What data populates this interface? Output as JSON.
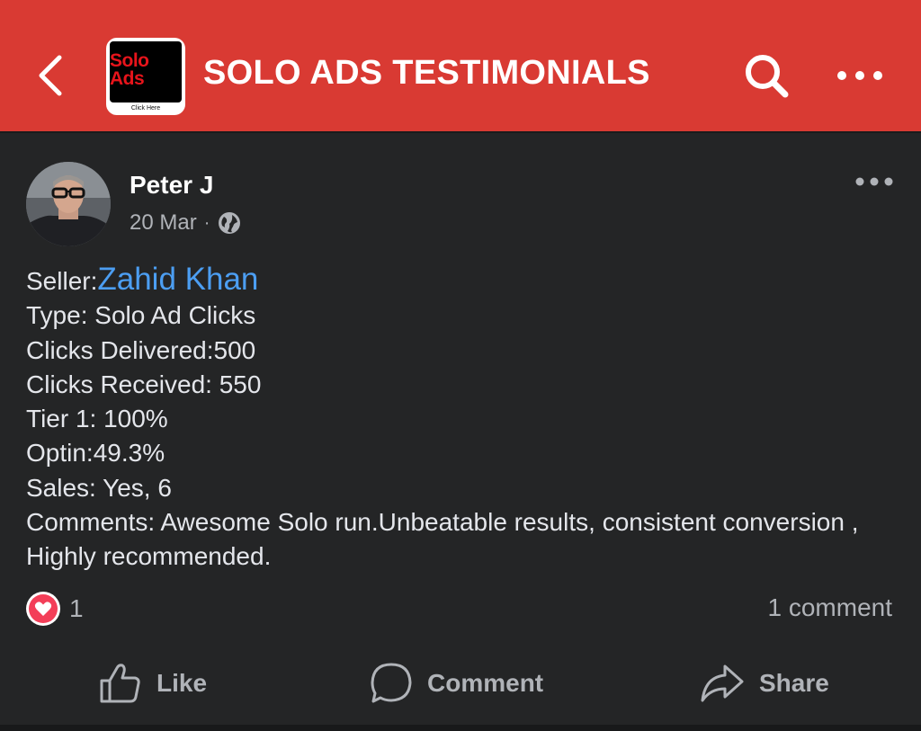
{
  "header": {
    "title": "SOLO ADS TESTIMONIALS",
    "logo_text_1": "Solo",
    "logo_text_2": "Ads",
    "logo_caption": "Click Here",
    "background_color": "#d93a33",
    "icons": [
      "chevron-left-icon",
      "search-icon",
      "more-horizontal-icon"
    ]
  },
  "post": {
    "author": "Peter J",
    "date": "20 Mar",
    "separator": "·",
    "privacy_icon": "globe-icon",
    "seller_label": "Seller:",
    "seller_name": "Zahid Khan",
    "type": "Type: Solo Ad Clicks",
    "clicks_delivered": "Clicks Delivered:500",
    "clicks_received": "Clicks Received: 550",
    "tier1": "Tier 1: 100%",
    "optin": "Optin:49.3%",
    "sales": "Sales: Yes, 6",
    "comments": "Comments: Awesome Solo run.Unbeatable results, consistent conversion , Highly recommended.",
    "link_color": "#4c9ef2"
  },
  "engagement": {
    "reaction_icon": "heart-icon",
    "reaction_count": "1",
    "comment_count": "1 comment"
  },
  "actions": {
    "like": "Like",
    "comment": "Comment",
    "share": "Share"
  }
}
